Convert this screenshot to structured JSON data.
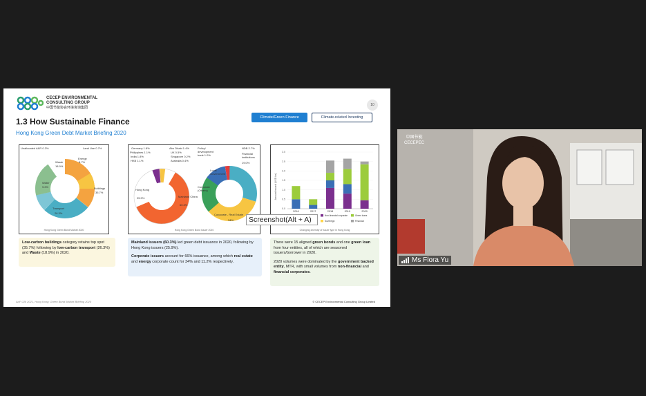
{
  "slide": {
    "logo_name": "CECEP ENVIRONMENTAL",
    "logo_name2": "CONSULTING GROUP",
    "logo_cn": "中国节能协会环境咨询集团",
    "page_number": "10",
    "title": "1.3 How Sustainable Finance",
    "subtitle": "Hong Kong Green Debt Market Briefing 2020",
    "tabs": [
      "Climate/Green Finance",
      "Climate-related Investing"
    ],
    "footer_left": "AoF CBI 2021, Hong Kong: Green Bond Market Briefing 2020",
    "footer_right": "© CECEP Environmental Consulting Group Limited"
  },
  "panel1": {
    "caption": "Hong Kong Green Bond Market 2020",
    "labels": {
      "unallocated": "Unallocated A&R 0.3%",
      "land_use": "Land Use 0.7%",
      "energy": "Energy",
      "energy_pct": "8.7%",
      "buildings": "Buildings",
      "buildings_pct": "35.7%",
      "transport": "Transport",
      "transport_pct": "26.3%",
      "water": "Water",
      "water_pct": "9.2%",
      "waste": "Waste",
      "waste_pct": "18.9%"
    }
  },
  "panel2": {
    "caption": "Hong Kong Green Bond Issuer 2020",
    "labels": {
      "germany": "Germany 1.8%",
      "philippines": "Philippines 1.1%",
      "india": "India 1.8%",
      "hkb": "HKB 1.1%",
      "abu_dhabi": "Abu Dhabi 1.4%",
      "uk": "UK 0.5%",
      "singapore": "Singapore 0.2%",
      "australia": "Australia 0.4%",
      "hong_kong": "Hong Kong",
      "hong_kong_pct": "25.9%",
      "mainland": "Mainland China",
      "mainland_pct": "60.3%",
      "policy_bank": "Policy/ development bank 1.0%",
      "ndb": "NDB 2.7%",
      "financial": "Financial institutions",
      "financial_pct": "19.0%",
      "local_gov": "Local Government",
      "corporate_others": "Corporate (Others)",
      "corporate_real_estate": "Corporate - Real Estate",
      "corporate_re_pct": "34%"
    }
  },
  "panel3": {
    "caption": "Changing diversity of issuer type in Hong Kong",
    "ylabel": "Amount issued (USD bn)",
    "legend": [
      "Non-financial corporate",
      "Sovereign",
      "Financial",
      "Green loans"
    ]
  },
  "chart_data": {
    "type": "bar",
    "categories": [
      "2016",
      "2017",
      "2018",
      "2019",
      "2020"
    ],
    "ylim": [
      0,
      3.0
    ],
    "yticks": [
      "0.0",
      "0.5",
      "1.0",
      "1.5",
      "2.0",
      "2.5",
      "3.0"
    ],
    "series": [
      {
        "name": "Non-financial corporate",
        "color": "#7b2f8e",
        "values": [
          0.0,
          0.0,
          1.1,
          0.8,
          0.45
        ]
      },
      {
        "name": "Sovereign",
        "color": "#ffd54a",
        "values": [
          0.0,
          0.0,
          0.0,
          0.0,
          0.0
        ]
      },
      {
        "name": "Financial",
        "color": "#3a6fb5",
        "values": [
          0.5,
          0.2,
          0.4,
          0.5,
          0.0
        ]
      },
      {
        "name": "Green loans",
        "color": "#9ccc3c",
        "values": [
          0.7,
          0.3,
          0.4,
          0.8,
          1.9
        ]
      },
      {
        "name": "",
        "color": "#a4a4a4",
        "values": [
          0.0,
          0.0,
          0.65,
          0.55,
          0.15
        ]
      }
    ]
  },
  "notes": {
    "n1_b1": "Low-carbon buildings",
    "n1_t1": " category retains top spot (35.7%) following by ",
    "n1_b2": "low-carbon transport",
    "n1_t2": " (26.3%) and ",
    "n1_b3": "Waste",
    "n1_t3": " (18.9%) in 2020.",
    "n2_b1": "Mainland issuers (60.3%)",
    "n2_t1": " led green debt issuance in 2020, following by Hong Kong issuers (25.9%).",
    "n2_b2": "Corporate issuers",
    "n2_t2": " account for 66% issuance, among which ",
    "n2_b3": "real estate",
    "n2_t3": " and ",
    "n2_b4": "energy",
    "n2_t4": " corporate count for 34% and 11.2% respectively.",
    "n3_t1": "There were 15 aligned ",
    "n3_b1": "green bonds",
    "n3_t2": " and one ",
    "n3_b2": "green loan",
    "n3_t3": " from four entities, all of which are seasoned issuers/borrower in 2020.",
    "n3_t4": "2020 volumes were dominated by the ",
    "n3_b3": "government backed entity",
    "n3_t5": ", MTR, with small volumes from ",
    "n3_b4": "non-financial",
    "n3_t6": " and ",
    "n3_b5": "financial corporates",
    "n3_t7": "."
  },
  "tooltip": "Screenshot(Alt + A)",
  "participant": {
    "name": "Ms Flora Yu",
    "bg_logo_cn": "中国节能",
    "bg_logo": "CECEPEC"
  }
}
